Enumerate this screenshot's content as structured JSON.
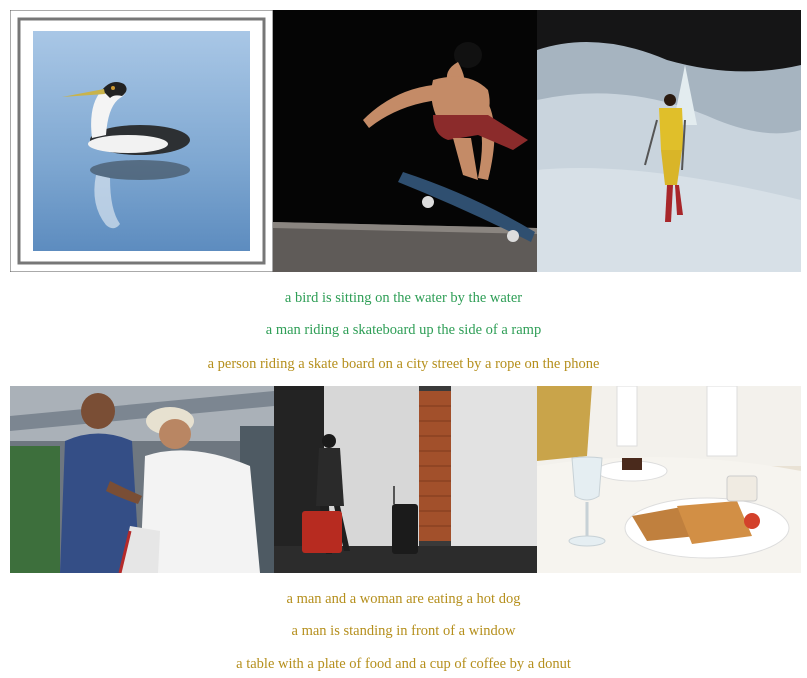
{
  "row1": {
    "captions": [
      {
        "text": "a bird is sitting on the water by the water",
        "color": "#2e9e56"
      },
      {
        "text": "a man riding a skateboard up the side of a ramp",
        "color": "#2e9e56"
      },
      {
        "text": "a person riding a skate board on a city street by a rope on the phone",
        "color": "#b58f1c"
      }
    ]
  },
  "row2": {
    "captions": [
      {
        "text": "a man and a woman are eating a hot dog",
        "color": "#b58f1c"
      },
      {
        "text": "a man is standing in front of a window",
        "color": "#b58f1c"
      },
      {
        "text": "a table with a plate of food and a cup of coffee by a donut",
        "color": "#b58f1c"
      }
    ]
  },
  "colors": {
    "correct": "#2e9e56",
    "incorrect": "#b58f1c"
  }
}
